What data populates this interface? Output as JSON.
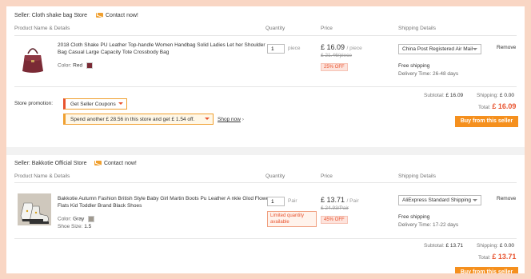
{
  "headers": {
    "product": "Product Name & Details",
    "quantity": "Quantity",
    "price": "Price",
    "shipping": "Shipping Details"
  },
  "contact_label": "Contact now!",
  "remove_label": "Remove",
  "buy_label": "Buy from this seller",
  "store1": {
    "seller": "Seller: Cloth shake bag Store",
    "title": "2018 Cloth Shake PU Leather Top-handle Women Handbag Solid Ladies Let her Shoulder Bag Casual Large Capacity Tote Crossbody Bag",
    "color_label": "Color:",
    "color_value": "Red",
    "quantity": "1",
    "unit": "piece",
    "price": "£ 16.09",
    "price_unit": "/ piece",
    "old_price": "£ 21.46/piece",
    "discount": "25% OFF",
    "shipping_method": "China Post Registered Air Mail",
    "free_shipping": "Free shipping",
    "delivery_time": "Delivery Time: 26-48 days",
    "promotion_label": "Store promotion:",
    "coupon_label": "Get Seller Coupons",
    "spend_text": "Spend another £ 28.56 in this store and get £ 1.54 off.",
    "shop_now": "Shop now",
    "subtotal_label": "Subtotal:",
    "subtotal": "£ 16.09",
    "shipping_label": "Shipping:",
    "shipping_cost": "£ 0.00",
    "total_label": "Total:",
    "total": "£ 16.09"
  },
  "store2": {
    "seller": "Seller: Bakkotie Official Store",
    "title": "Bakkotie Autumn Fashion British Style Baby Girl Martin Boots Pu Leather A nkle Glod Flower Flats Kid Toddler Brand Black Shoes",
    "color_label": "Color:",
    "color_value": "Gray",
    "size_label": "Shoe Size:",
    "size_value": "1.5",
    "quantity": "1",
    "unit": "Pair",
    "limited": "Limited quantity available",
    "price": "£ 13.71",
    "price_unit": "/ Pair",
    "old_price": "£ 24.93/Pair",
    "discount": "45% OFF",
    "shipping_method": "AliExpress Standard Shipping",
    "free_shipping": "Free shipping",
    "delivery_time": "Delivery Time: 17-22 days",
    "subtotal_label": "Subtotal:",
    "subtotal": "£ 13.71",
    "shipping_label": "Shipping:",
    "shipping_cost": "£ 0.00",
    "total_label": "Total:",
    "total": "£ 13.71"
  },
  "colors": {
    "accent": "#f5901e",
    "price_red": "#e8532f",
    "frame": "#f9d6c4"
  }
}
